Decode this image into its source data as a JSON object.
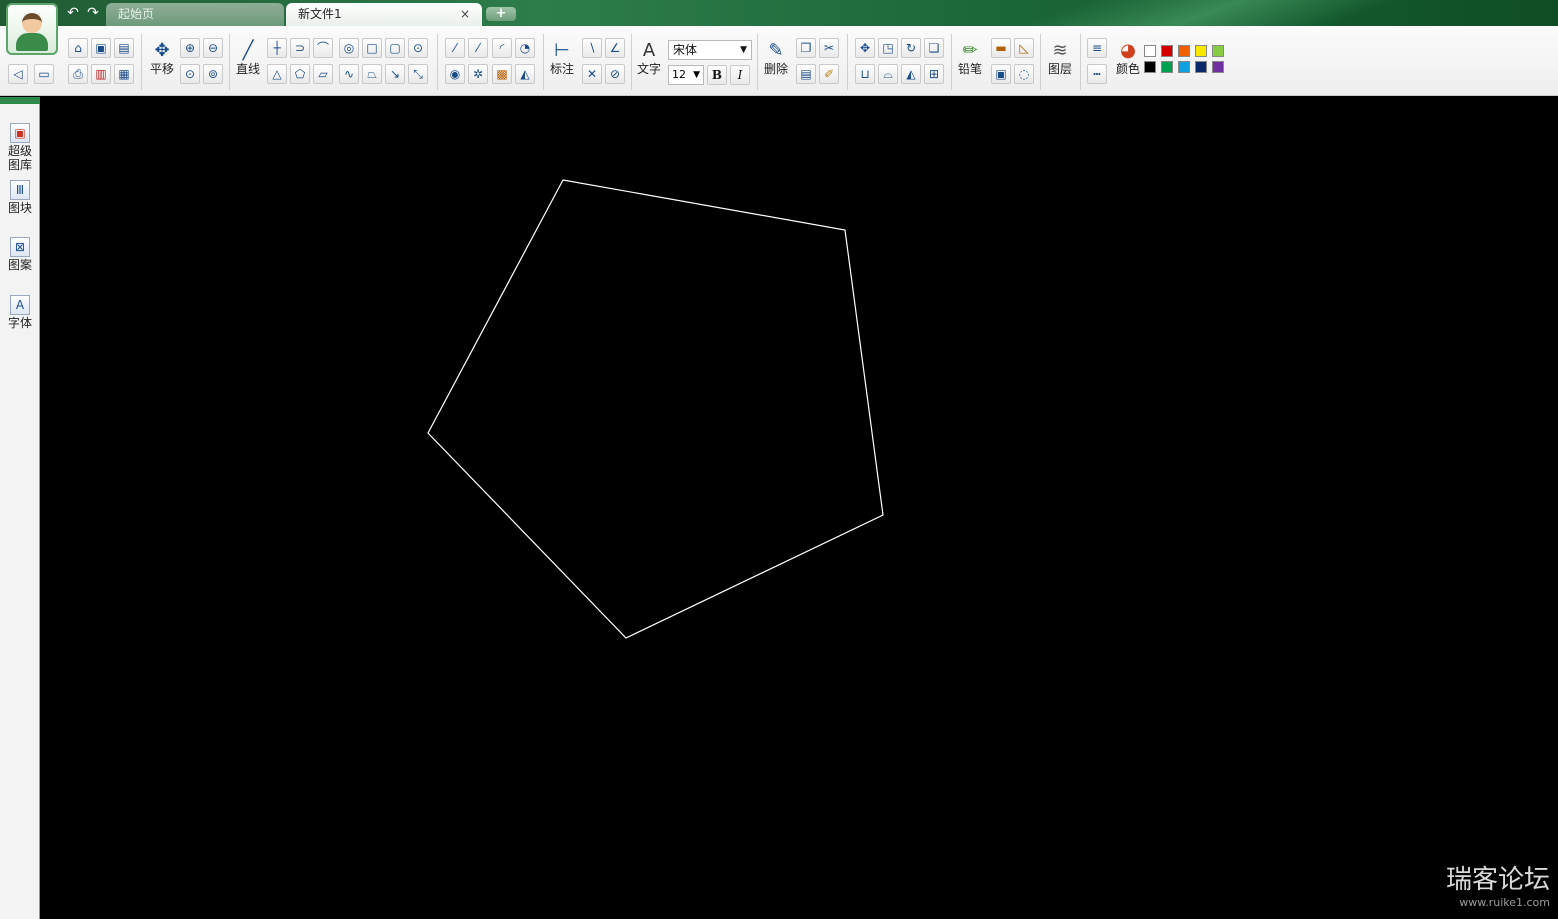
{
  "tabs": {
    "start": "起始页",
    "new_file": "新文件1",
    "close": "×",
    "add": "+"
  },
  "toolbar": {
    "pan": "平移",
    "line": "直线",
    "dimension": "标注",
    "text": "文字",
    "font": "宋体",
    "font_size": "12",
    "bold": "B",
    "italic": "I",
    "delete": "删除",
    "pencil": "铅笔",
    "layer": "图层",
    "color": "颜色"
  },
  "swatches": [
    "#ffffff",
    "#d40000",
    "#f06000",
    "#f8e800",
    "#88cc44",
    "#000000",
    "#00a050",
    "#10a0e0",
    "#0a2a6a",
    "#7030a0"
  ],
  "sidebar": {
    "gallery_line1": "超级",
    "gallery_line2": "图库",
    "blocks": "图块",
    "pattern": "图案",
    "font": "字体"
  },
  "watermark": {
    "text": "瑞客论坛",
    "url": "www.ruike1.com"
  },
  "colors": {
    "accent": "#2e8a4a",
    "canvas": "#000000",
    "stroke": "#ffffff"
  }
}
